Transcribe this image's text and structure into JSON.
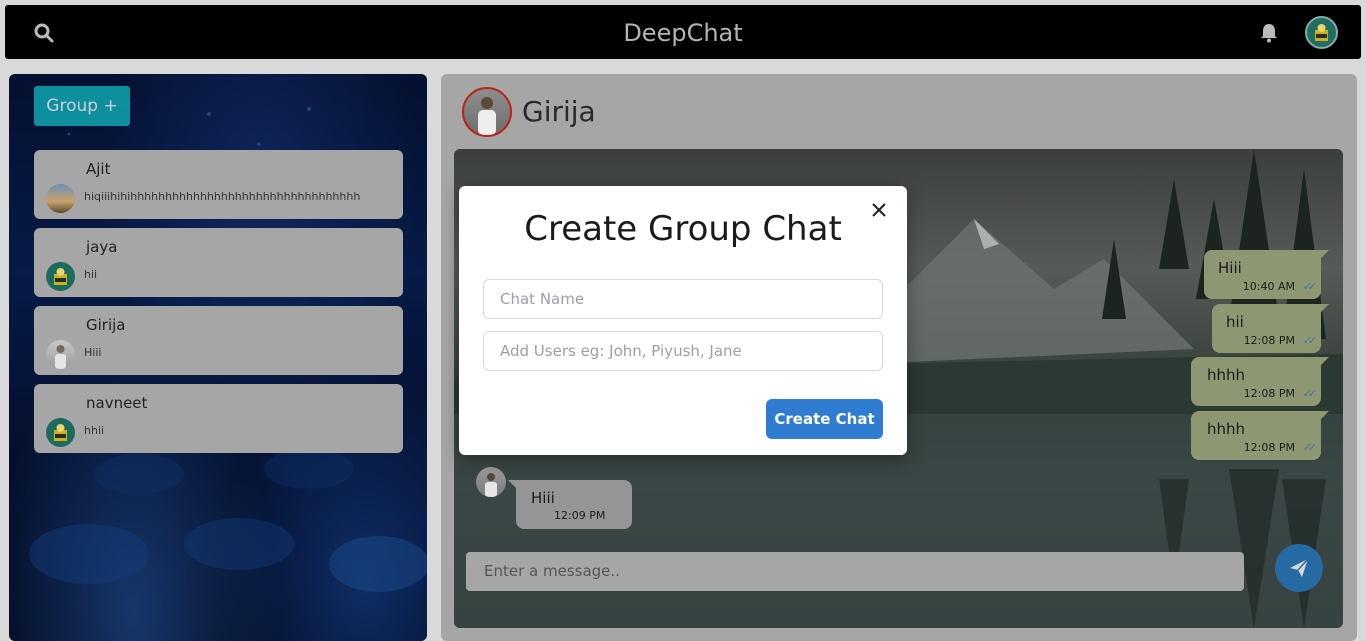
{
  "app": {
    "title": "DeepChat"
  },
  "topbar": {
    "search_icon": "search-icon",
    "bell_icon": "bell-icon",
    "avatar_icon": "user-avatar"
  },
  "sidebar": {
    "group_button": "Group +",
    "chats": [
      {
        "name": "Ajit",
        "last_message": "hiqiiihihihhhhhhhhhhhhhhhhhhhhhhhhhhhhhhhhh"
      },
      {
        "name": "jaya",
        "last_message": "hii"
      },
      {
        "name": "Girija",
        "last_message": "Hiii"
      },
      {
        "name": "navneet",
        "last_message": "hhii"
      }
    ]
  },
  "conversation": {
    "contact_name": "Girija",
    "messages_out": [
      {
        "text": "Hiii",
        "time": "10:40 AM"
      },
      {
        "text": "hii",
        "time": "12:08 PM"
      },
      {
        "text": "hhhh",
        "time": "12:08 PM"
      },
      {
        "text": "hhhh",
        "time": "12:08 PM"
      }
    ],
    "messages_in": [
      {
        "text": "Hiii",
        "time": "12:09 PM"
      }
    ],
    "input_placeholder": "Enter a message..",
    "send_icon": "send-icon"
  },
  "modal": {
    "title": "Create Group Chat",
    "chat_name_placeholder": "Chat Name",
    "users_placeholder": "Add Users eg: John, Piyush, Jane",
    "create_button": "Create Chat",
    "close_icon": "close-icon"
  },
  "colors": {
    "topbar": "#000000",
    "accent": "#2f7cd0",
    "group_button": "#0e8f9e",
    "bubble_out": "#8d9873"
  }
}
